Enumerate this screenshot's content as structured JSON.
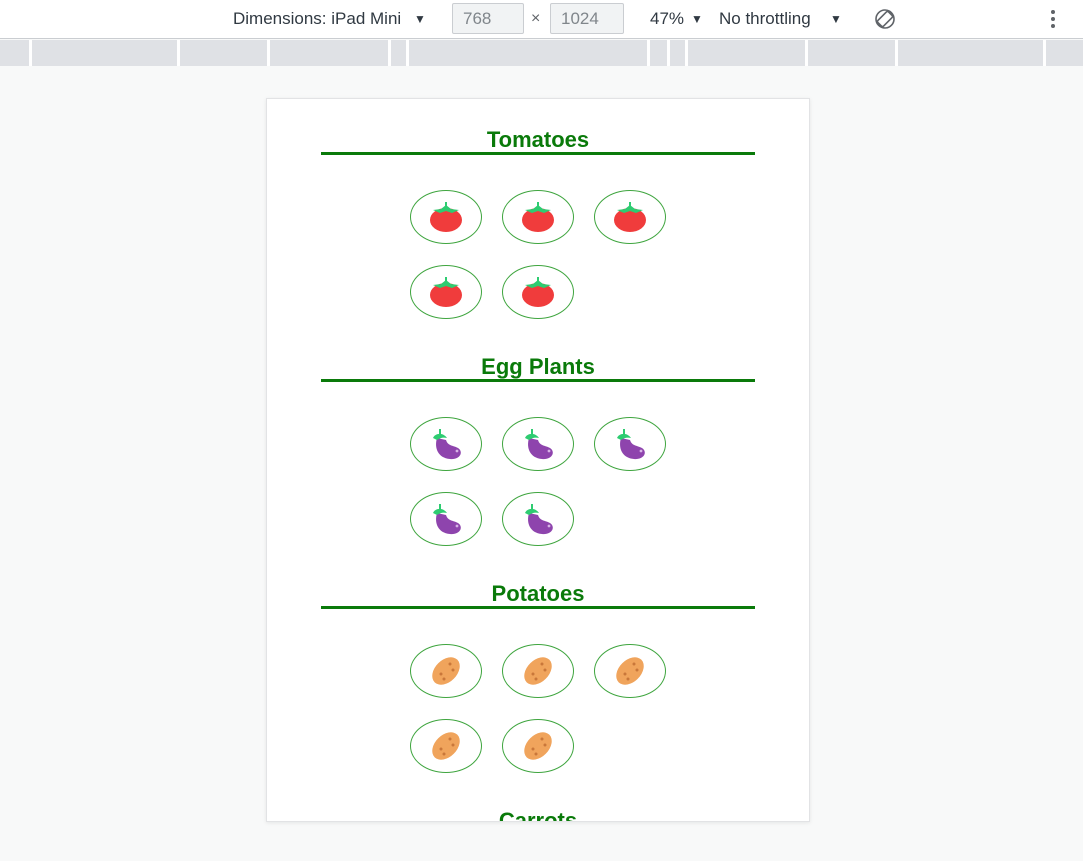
{
  "toolbar": {
    "dimensions_label": "Dimensions: iPad Mini",
    "width_value": "768",
    "height_value": "1024",
    "times_symbol": "×",
    "zoom_label": "47%",
    "throttling_label": "No throttling"
  },
  "sections": [
    {
      "title": "Tomatoes",
      "item_icon": "tomato-icon",
      "count": 5,
      "colors": {
        "body": "#f03c3c",
        "leaf": "#2ecc71"
      }
    },
    {
      "title": "Egg Plants",
      "item_icon": "eggplant-icon",
      "count": 5,
      "colors": {
        "body": "#8e44ad",
        "leaf": "#2ecc71"
      }
    },
    {
      "title": "Potatoes",
      "item_icon": "potato-icon",
      "count": 5,
      "colors": {
        "body": "#f0a45c",
        "spots": "#c9773a"
      }
    },
    {
      "title": "Carrots"
    }
  ],
  "colors": {
    "accent": "#0a7a0a",
    "item_border": "#3fa53f"
  }
}
